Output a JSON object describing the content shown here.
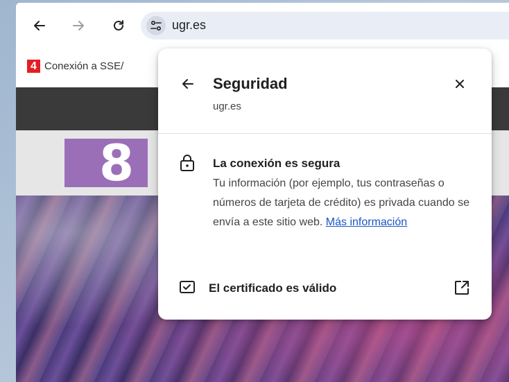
{
  "toolbar": {
    "back_icon": "arrow-left-icon",
    "forward_icon": "arrow-right-icon",
    "reload_icon": "reload-icon",
    "site_info_icon": "tune-icon",
    "url": "ugr.es"
  },
  "bookmarks": {
    "items": [
      {
        "label": "Conexión a SSE/",
        "favicon_text": "4",
        "favicon_color": "#e31e24"
      }
    ],
    "overflow": "..."
  },
  "page": {
    "logo_digit": "8",
    "logo_color": "#9b6fb8"
  },
  "popup": {
    "title": "Seguridad",
    "subtitle": "ugr.es",
    "connection": {
      "heading": "La conexión es segura",
      "body": "Tu información (por ejemplo, tus contraseñas o números de tarjeta de crédito) es privada cuando se envía a este sitio web.",
      "link": "Más información"
    },
    "certificate": {
      "label": "El certificado es válido"
    }
  },
  "colors": {
    "link": "#1a56c4",
    "omnibox_bg": "#e9eef6"
  }
}
